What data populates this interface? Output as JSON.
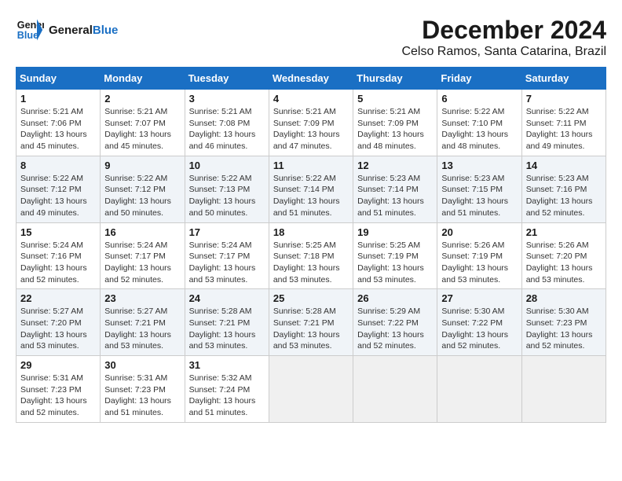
{
  "header": {
    "logo_general": "General",
    "logo_blue": "Blue",
    "title": "December 2024",
    "subtitle": "Celso Ramos, Santa Catarina, Brazil"
  },
  "calendar": {
    "days_of_week": [
      "Sunday",
      "Monday",
      "Tuesday",
      "Wednesday",
      "Thursday",
      "Friday",
      "Saturday"
    ],
    "weeks": [
      [
        {
          "day": "",
          "detail": ""
        },
        {
          "day": "2",
          "detail": "Sunrise: 5:21 AM\nSunset: 7:07 PM\nDaylight: 13 hours and 45 minutes."
        },
        {
          "day": "3",
          "detail": "Sunrise: 5:21 AM\nSunset: 7:08 PM\nDaylight: 13 hours and 46 minutes."
        },
        {
          "day": "4",
          "detail": "Sunrise: 5:21 AM\nSunset: 7:09 PM\nDaylight: 13 hours and 47 minutes."
        },
        {
          "day": "5",
          "detail": "Sunrise: 5:21 AM\nSunset: 7:09 PM\nDaylight: 13 hours and 48 minutes."
        },
        {
          "day": "6",
          "detail": "Sunrise: 5:22 AM\nSunset: 7:10 PM\nDaylight: 13 hours and 48 minutes."
        },
        {
          "day": "7",
          "detail": "Sunrise: 5:22 AM\nSunset: 7:11 PM\nDaylight: 13 hours and 49 minutes."
        }
      ],
      [
        {
          "day": "8",
          "detail": "Sunrise: 5:22 AM\nSunset: 7:12 PM\nDaylight: 13 hours and 49 minutes."
        },
        {
          "day": "9",
          "detail": "Sunrise: 5:22 AM\nSunset: 7:12 PM\nDaylight: 13 hours and 50 minutes."
        },
        {
          "day": "10",
          "detail": "Sunrise: 5:22 AM\nSunset: 7:13 PM\nDaylight: 13 hours and 50 minutes."
        },
        {
          "day": "11",
          "detail": "Sunrise: 5:22 AM\nSunset: 7:14 PM\nDaylight: 13 hours and 51 minutes."
        },
        {
          "day": "12",
          "detail": "Sunrise: 5:23 AM\nSunset: 7:14 PM\nDaylight: 13 hours and 51 minutes."
        },
        {
          "day": "13",
          "detail": "Sunrise: 5:23 AM\nSunset: 7:15 PM\nDaylight: 13 hours and 51 minutes."
        },
        {
          "day": "14",
          "detail": "Sunrise: 5:23 AM\nSunset: 7:16 PM\nDaylight: 13 hours and 52 minutes."
        }
      ],
      [
        {
          "day": "15",
          "detail": "Sunrise: 5:24 AM\nSunset: 7:16 PM\nDaylight: 13 hours and 52 minutes."
        },
        {
          "day": "16",
          "detail": "Sunrise: 5:24 AM\nSunset: 7:17 PM\nDaylight: 13 hours and 52 minutes."
        },
        {
          "day": "17",
          "detail": "Sunrise: 5:24 AM\nSunset: 7:17 PM\nDaylight: 13 hours and 53 minutes."
        },
        {
          "day": "18",
          "detail": "Sunrise: 5:25 AM\nSunset: 7:18 PM\nDaylight: 13 hours and 53 minutes."
        },
        {
          "day": "19",
          "detail": "Sunrise: 5:25 AM\nSunset: 7:19 PM\nDaylight: 13 hours and 53 minutes."
        },
        {
          "day": "20",
          "detail": "Sunrise: 5:26 AM\nSunset: 7:19 PM\nDaylight: 13 hours and 53 minutes."
        },
        {
          "day": "21",
          "detail": "Sunrise: 5:26 AM\nSunset: 7:20 PM\nDaylight: 13 hours and 53 minutes."
        }
      ],
      [
        {
          "day": "22",
          "detail": "Sunrise: 5:27 AM\nSunset: 7:20 PM\nDaylight: 13 hours and 53 minutes."
        },
        {
          "day": "23",
          "detail": "Sunrise: 5:27 AM\nSunset: 7:21 PM\nDaylight: 13 hours and 53 minutes."
        },
        {
          "day": "24",
          "detail": "Sunrise: 5:28 AM\nSunset: 7:21 PM\nDaylight: 13 hours and 53 minutes."
        },
        {
          "day": "25",
          "detail": "Sunrise: 5:28 AM\nSunset: 7:21 PM\nDaylight: 13 hours and 53 minutes."
        },
        {
          "day": "26",
          "detail": "Sunrise: 5:29 AM\nSunset: 7:22 PM\nDaylight: 13 hours and 52 minutes."
        },
        {
          "day": "27",
          "detail": "Sunrise: 5:30 AM\nSunset: 7:22 PM\nDaylight: 13 hours and 52 minutes."
        },
        {
          "day": "28",
          "detail": "Sunrise: 5:30 AM\nSunset: 7:23 PM\nDaylight: 13 hours and 52 minutes."
        }
      ],
      [
        {
          "day": "29",
          "detail": "Sunrise: 5:31 AM\nSunset: 7:23 PM\nDaylight: 13 hours and 52 minutes."
        },
        {
          "day": "30",
          "detail": "Sunrise: 5:31 AM\nSunset: 7:23 PM\nDaylight: 13 hours and 51 minutes."
        },
        {
          "day": "31",
          "detail": "Sunrise: 5:32 AM\nSunset: 7:24 PM\nDaylight: 13 hours and 51 minutes."
        },
        {
          "day": "",
          "detail": ""
        },
        {
          "day": "",
          "detail": ""
        },
        {
          "day": "",
          "detail": ""
        },
        {
          "day": "",
          "detail": ""
        }
      ]
    ],
    "week1_sunday": {
      "day": "1",
      "detail": "Sunrise: 5:21 AM\nSunset: 7:06 PM\nDaylight: 13 hours and 45 minutes."
    }
  }
}
